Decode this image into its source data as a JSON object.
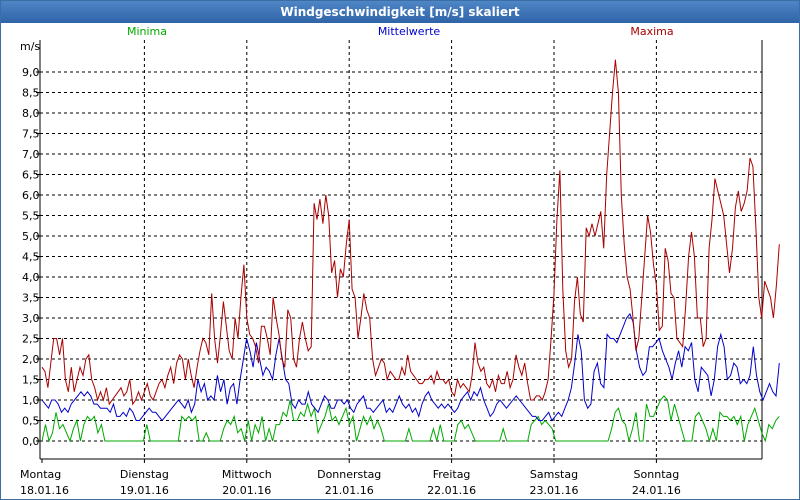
{
  "window": {
    "title": "Windgeschwindigkeit [m/s] skaliert"
  },
  "colors": {
    "minima": "#00aa00",
    "mittelwerte": "#0000cc",
    "maxima": "#aa0000",
    "grid": "#000000",
    "titlebar": "#3a70b0"
  },
  "chart_data": {
    "type": "line",
    "ylabel": "m/s",
    "ylim": [
      0,
      9.5
    ],
    "y_ticks": [
      "0,0",
      "0,5",
      "1,0",
      "1,5",
      "2,0",
      "2,5",
      "3,0",
      "3,5",
      "4,0",
      "4,5",
      "5,0",
      "5,5",
      "6,0",
      "6,5",
      "7,0",
      "7,5",
      "8,0",
      "8,5",
      "9,0"
    ],
    "x_range": [
      0,
      7.2
    ],
    "day_ticks": [
      {
        "x": 0,
        "day": "Montag",
        "date": "18.01.16"
      },
      {
        "x": 1,
        "day": "Dienstag",
        "date": "19.01.16"
      },
      {
        "x": 2,
        "day": "Mittwoch",
        "date": "20.01.16"
      },
      {
        "x": 3,
        "day": "Donnerstag",
        "date": "21.01.16"
      },
      {
        "x": 4,
        "day": "Freitag",
        "date": "22.01.16"
      },
      {
        "x": 5,
        "day": "Samstag",
        "date": "23.01.16"
      },
      {
        "x": 6,
        "day": "Sonntag",
        "date": "24.01.16"
      }
    ],
    "grid": true,
    "legend": "top",
    "series": [
      {
        "name": "Minima",
        "color": "#00aa00",
        "values": [
          0.0,
          0.4,
          0.0,
          0.2,
          0.7,
          0.3,
          0.4,
          0.2,
          0.0,
          0.3,
          0.5,
          0.0,
          0.4,
          0.6,
          0.5,
          0.6,
          0.2,
          0.4,
          0.0,
          0.0,
          0.0,
          0.0,
          0.0,
          0.0,
          0.0,
          0.0,
          0.0,
          0.0,
          0.0,
          0.0,
          0.4,
          0.0,
          0.0,
          0.0,
          0.0,
          0.0,
          0.0,
          0.0,
          0.0,
          0.0,
          0.6,
          0.5,
          0.6,
          0.5,
          0.6,
          0.0,
          0.0,
          0.2,
          0.0,
          0.0,
          0.0,
          0.0,
          0.3,
          0.5,
          0.4,
          0.6,
          0.2,
          0.3,
          0.0,
          0.5,
          0.0,
          0.4,
          0.2,
          0.6,
          0.0,
          0.3,
          0.0,
          0.4,
          0.4,
          0.7,
          0.6,
          1.0,
          0.5,
          0.5,
          0.7,
          0.6,
          0.9,
          0.6,
          0.8,
          0.2,
          0.4,
          0.6,
          0.9,
          0.5,
          0.6,
          0.4,
          0.6,
          0.8,
          0.4,
          0.6,
          0.0,
          0.3,
          0.6,
          0.4,
          0.6,
          0.3,
          0.5,
          0.3,
          0.0,
          0.0,
          0.0,
          0.0,
          0.0,
          0.0,
          0.0,
          0.3,
          0.0,
          0.0,
          0.0,
          0.0,
          0.0,
          0.0,
          0.3,
          0.0,
          0.4,
          0.0,
          0.0,
          0.0,
          0.0,
          0.4,
          0.5,
          0.3,
          0.4,
          0.2,
          0.0,
          0.0,
          0.0,
          0.0,
          0.0,
          0.0,
          0.0,
          0.0,
          0.3,
          0.0,
          0.0,
          0.0,
          0.0,
          0.0,
          0.0,
          0.0,
          0.4,
          0.5,
          0.6,
          0.4,
          0.5,
          0.4,
          0.3,
          0.0,
          0.0,
          0.0,
          0.0,
          0.0,
          0.0,
          0.0,
          0.0,
          0.0,
          0.0,
          0.0,
          0.0,
          0.0,
          0.0,
          0.0,
          0.0,
          0.3,
          0.7,
          0.8,
          0.5,
          0.4,
          0.0,
          0.3,
          0.7,
          0.0,
          0.0,
          0.9,
          0.6,
          0.6,
          0.8,
          1.0,
          1.1,
          1.0,
          0.5,
          0.9,
          0.6,
          0.3,
          0.0,
          0.0,
          0.0,
          0.6,
          0.7,
          0.5,
          0.3,
          0.0,
          0.3,
          0.0,
          0.7,
          0.6,
          0.6,
          0.5,
          0.6,
          0.4,
          0.6,
          0.0,
          0.4,
          0.6,
          0.8,
          0.5,
          0.2,
          0.0,
          0.4,
          0.3,
          0.5,
          0.6
        ]
      },
      {
        "name": "Mittelwerte",
        "color": "#0000cc",
        "values": [
          1.0,
          0.9,
          0.8,
          1.0,
          1.0,
          0.9,
          0.7,
          0.8,
          0.7,
          0.9,
          1.0,
          1.1,
          1.2,
          1.1,
          1.2,
          1.1,
          0.9,
          0.9,
          0.8,
          0.8,
          0.8,
          0.7,
          0.9,
          0.6,
          0.6,
          0.7,
          0.6,
          0.8,
          0.7,
          0.5,
          0.5,
          0.6,
          0.7,
          0.8,
          0.7,
          0.7,
          0.6,
          0.5,
          0.6,
          0.7,
          0.8,
          0.9,
          1.0,
          0.9,
          0.8,
          1.0,
          0.7,
          0.9,
          1.5,
          1.2,
          1.4,
          1.0,
          1.1,
          1.0,
          1.6,
          1.2,
          1.5,
          0.9,
          1.3,
          1.4,
          0.9,
          1.5,
          2.0,
          2.5,
          2.2,
          1.8,
          2.4,
          2.0,
          1.6,
          1.8,
          1.7,
          1.5,
          2.1,
          2.5,
          2.0,
          1.5,
          1.4,
          0.9,
          0.8,
          1.0,
          0.9,
          0.9,
          1.2,
          0.9,
          0.8,
          0.7,
          0.9,
          1.1,
          1.0,
          0.8,
          0.8,
          1.0,
          1.0,
          0.9,
          1.0,
          0.8,
          0.7,
          0.9,
          1.0,
          1.1,
          0.8,
          0.8,
          0.7,
          0.8,
          0.9,
          1.0,
          0.7,
          0.8,
          0.7,
          0.9,
          1.1,
          0.9,
          0.8,
          0.9,
          0.7,
          0.8,
          0.6,
          0.9,
          1.1,
          1.2,
          1.0,
          0.9,
          0.8,
          0.9,
          0.8,
          0.9,
          0.8,
          0.7,
          0.8,
          1.0,
          1.1,
          1.2,
          1.0,
          1.2,
          1.1,
          1.3,
          1.0,
          0.8,
          0.6,
          0.7,
          0.9,
          1.0,
          0.9,
          0.8,
          0.9,
          1.0,
          1.1,
          1.0,
          0.9,
          0.8,
          0.7,
          0.6,
          0.6,
          0.5,
          0.5,
          0.6,
          0.7,
          0.5,
          0.6,
          0.7,
          0.6,
          0.8,
          1.0,
          1.3,
          1.9,
          2.6,
          2.2,
          1.0,
          0.8,
          0.9,
          1.7,
          1.9,
          1.4,
          1.3,
          2.6,
          2.5,
          2.5,
          2.4,
          2.6,
          2.8,
          3.0,
          3.1,
          2.9,
          2.2,
          1.8,
          1.6,
          1.7,
          2.3,
          2.3,
          2.4,
          2.5,
          2.2,
          2.0,
          1.8,
          1.5,
          1.9,
          2.2,
          1.8,
          2.3,
          2.2,
          2.4,
          1.5,
          1.2,
          1.8,
          1.7,
          1.6,
          1.1,
          1.5,
          2.3,
          2.6,
          2.3,
          1.5,
          1.6,
          1.9,
          1.8,
          1.4,
          1.5,
          1.4,
          1.6,
          2.3,
          1.6,
          1.2,
          1.0,
          1.2,
          1.4,
          1.2,
          1.1,
          1.9
        ]
      },
      {
        "name": "Maxima",
        "color": "#aa0000",
        "values": [
          1.8,
          1.7,
          1.3,
          1.9,
          2.5,
          2.5,
          2.1,
          2.5,
          1.5,
          1.2,
          1.8,
          1.2,
          1.5,
          1.8,
          1.6,
          2.0,
          2.1,
          1.5,
          1.3,
          1.0,
          1.2,
          1.0,
          1.3,
          0.9,
          1.0,
          1.1,
          1.2,
          1.3,
          1.1,
          1.2,
          1.5,
          0.9,
          1.0,
          1.2,
          1.0,
          1.2,
          1.4,
          1.1,
          1.0,
          1.2,
          1.4,
          1.5,
          1.3,
          1.6,
          1.8,
          1.4,
          1.9,
          2.1,
          2.0,
          1.5,
          2.0,
          1.6,
          1.3,
          1.8,
          2.2,
          2.5,
          2.4,
          2.1,
          3.6,
          2.5,
          1.9,
          2.6,
          3.4,
          2.8,
          2.2,
          2.0,
          3.0,
          2.5,
          3.5,
          4.3,
          3.0,
          2.6,
          2.5,
          2.3,
          1.9,
          2.8,
          2.8,
          2.5,
          2.1,
          3.5,
          3.0,
          2.6,
          2.0,
          1.8,
          3.2,
          3.0,
          2.0,
          1.8,
          2.5,
          2.9,
          2.5,
          2.2,
          2.3,
          5.8,
          5.4,
          5.9,
          5.3,
          6.0,
          5.5,
          4.1,
          4.4,
          3.5,
          4.2,
          4.0,
          4.8,
          5.4,
          3.7,
          3.5,
          2.5,
          3.0,
          3.6,
          3.2,
          3.0,
          2.0,
          1.6,
          1.8,
          2.0,
          1.9,
          1.5,
          1.7,
          1.6,
          1.5,
          1.5,
          1.8,
          1.6,
          2.1,
          1.7,
          1.6,
          1.5,
          1.4,
          1.4,
          1.5,
          1.5,
          1.6,
          1.4,
          1.7,
          1.5,
          1.5,
          1.4,
          1.5,
          1.2,
          1.1,
          1.5,
          1.3,
          1.4,
          1.3,
          1.2,
          1.6,
          2.4,
          1.9,
          1.7,
          1.8,
          1.4,
          1.3,
          1.5,
          1.2,
          1.6,
          1.4,
          1.4,
          1.7,
          1.3,
          1.5,
          2.1,
          1.8,
          1.6,
          1.9,
          1.4,
          1.0,
          1.0,
          1.1,
          1.1,
          1.0,
          1.2,
          1.5,
          2.5,
          3.6,
          5.4,
          6.6,
          3.7,
          2.2,
          1.8,
          2.0,
          3.4,
          4.0,
          3.1,
          2.9,
          5.2,
          5.0,
          5.3,
          5.0,
          5.3,
          5.6,
          4.7,
          6.5,
          7.5,
          8.5,
          9.3,
          8.5,
          6.0,
          4.8,
          4.0,
          3.7,
          3.0,
          2.2,
          2.5,
          3.5,
          4.5,
          5.5,
          5.1,
          4.3,
          3.8,
          2.7,
          2.8,
          4.7,
          4.4,
          3.6,
          3.5,
          2.5,
          2.4,
          2.3,
          3.3,
          4.5,
          5.1,
          4.5,
          3.0,
          3.0,
          2.3,
          2.5,
          4.7,
          5.4,
          6.4,
          6.1,
          5.8,
          5.5,
          4.8,
          4.1,
          4.7,
          5.7,
          6.1,
          5.6,
          5.8,
          6.1,
          6.9,
          6.7,
          5.2,
          3.5,
          3.0,
          3.9,
          3.7,
          3.5,
          3.0,
          3.8,
          4.8
        ]
      }
    ]
  }
}
